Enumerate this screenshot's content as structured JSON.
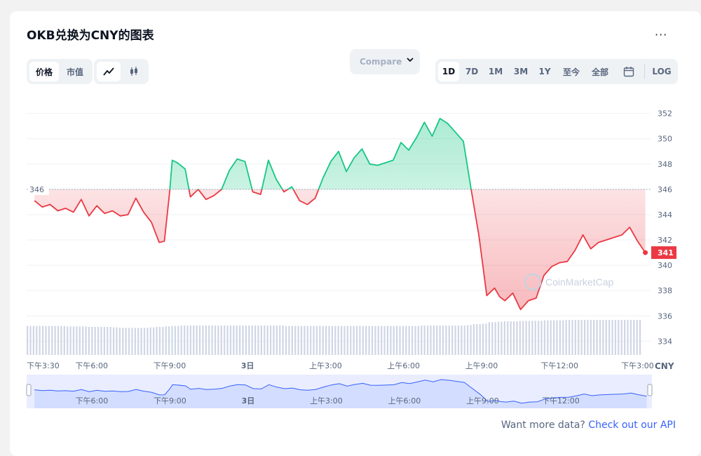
{
  "page": {
    "title": "OKB兑换为CNY的图表",
    "more_label": "···",
    "footer_text": "Want more data?",
    "footer_link": "Check out our API",
    "watermark": "CoinMarketCap"
  },
  "toolbar": {
    "metric_tabs": [
      "价格",
      "市值"
    ],
    "compare_label": "Compare",
    "ranges": [
      "1D",
      "7D",
      "1M",
      "3M",
      "1Y",
      "至今",
      "全部"
    ],
    "log_label": "LOG"
  },
  "chart_data": {
    "type": "line",
    "currency": "CNY",
    "yticks": [
      334,
      336,
      338,
      340,
      342,
      344,
      346,
      348,
      350,
      352
    ],
    "ylim": [
      332.8,
      353.2
    ],
    "reference_value": 346,
    "reference_label": "346",
    "current_value": 341,
    "current_label": "341",
    "xlim": [
      0,
      24
    ],
    "xticks": [
      {
        "t": 0.0,
        "label": "下午3:30"
      },
      {
        "t": 2.5,
        "label": "下午6:00"
      },
      {
        "t": 5.5,
        "label": "下午9:00"
      },
      {
        "t": 8.5,
        "label": "3日"
      },
      {
        "t": 11.5,
        "label": "上午3:00"
      },
      {
        "t": 14.5,
        "label": "上午6:00"
      },
      {
        "t": 17.5,
        "label": "上午9:00"
      },
      {
        "t": 20.5,
        "label": "下午12:00"
      },
      {
        "t": 23.5,
        "label": "下午3:00"
      }
    ],
    "navigator_ticks": [
      {
        "t": 2.5,
        "label": "下午6:00"
      },
      {
        "t": 5.5,
        "label": "下午9:00"
      },
      {
        "t": 8.5,
        "label": "3日"
      },
      {
        "t": 11.5,
        "label": "上午3:00"
      },
      {
        "t": 14.5,
        "label": "上午6:00"
      },
      {
        "t": 17.5,
        "label": "上午9:00"
      },
      {
        "t": 20.5,
        "label": "下午12:00"
      }
    ],
    "series": [
      {
        "x": [
          0.3,
          0.6,
          0.9,
          1.2,
          1.5,
          1.8,
          2.1,
          2.4,
          2.7,
          3.0,
          3.3,
          3.6,
          3.9,
          4.2,
          4.5,
          4.8,
          5.1,
          5.3,
          5.5,
          5.6,
          5.8,
          6.1,
          6.3,
          6.6,
          6.9,
          7.2,
          7.5,
          7.8,
          8.1,
          8.4,
          8.7,
          9.0,
          9.3,
          9.6,
          9.9,
          10.2,
          10.5,
          10.8,
          11.1,
          11.4,
          11.7,
          12.0,
          12.3,
          12.6,
          12.9,
          13.2,
          13.5,
          13.8,
          14.1,
          14.4,
          14.7,
          15.0,
          15.3,
          15.6,
          15.9,
          16.2,
          16.5,
          16.8,
          17.1,
          17.4,
          17.7,
          18.0,
          18.2,
          18.4,
          18.7,
          19.0,
          19.3,
          19.6,
          19.9,
          20.2,
          20.5,
          20.8,
          21.1,
          21.4,
          21.7,
          22.0,
          22.3,
          22.6,
          22.9,
          23.2,
          23.5,
          23.8
        ],
        "y": [
          345.1,
          344.6,
          344.8,
          344.3,
          344.5,
          344.2,
          345.2,
          343.9,
          344.7,
          344.1,
          344.3,
          343.9,
          344.0,
          345.3,
          344.2,
          343.4,
          341.8,
          341.9,
          345.8,
          348.3,
          348.1,
          347.6,
          345.4,
          346.0,
          345.2,
          345.5,
          346.0,
          347.5,
          348.4,
          348.2,
          345.8,
          345.6,
          348.3,
          346.8,
          345.8,
          346.2,
          345.1,
          344.8,
          345.3,
          346.9,
          348.2,
          349.0,
          347.4,
          348.5,
          349.2,
          348.0,
          347.9,
          348.1,
          348.3,
          349.7,
          349.1,
          350.1,
          351.3,
          350.2,
          351.6,
          351.2,
          350.5,
          349.8,
          346.0,
          342.3,
          337.6,
          338.2,
          337.5,
          337.2,
          337.8,
          336.5,
          337.2,
          337.4,
          339.2,
          339.9,
          340.2,
          340.3,
          341.2,
          342.4,
          341.3,
          341.8,
          342.0,
          342.2,
          342.4,
          343.0,
          341.9,
          341.0
        ],
        "volume": [
          0.62,
          0.62,
          0.62,
          0.62,
          0.62,
          0.61,
          0.61,
          0.61,
          0.6,
          0.6,
          0.6,
          0.59,
          0.58,
          0.58,
          0.58,
          0.58,
          0.59,
          0.6,
          0.61,
          0.62,
          0.63,
          0.63,
          0.63,
          0.63,
          0.63,
          0.63,
          0.63,
          0.63,
          0.63,
          0.63,
          0.63,
          0.63,
          0.63,
          0.63,
          0.62,
          0.62,
          0.62,
          0.62,
          0.62,
          0.62,
          0.62,
          0.62,
          0.62,
          0.62,
          0.62,
          0.62,
          0.62,
          0.62,
          0.62,
          0.62,
          0.62,
          0.62,
          0.63,
          0.63,
          0.63,
          0.63,
          0.63,
          0.63,
          0.64,
          0.66,
          0.67,
          0.7,
          0.71,
          0.72,
          0.72,
          0.73,
          0.73,
          0.73,
          0.74,
          0.74,
          0.74,
          0.75,
          0.75,
          0.75,
          0.75,
          0.75,
          0.75,
          0.75,
          0.75,
          0.75,
          0.75,
          0.75
        ]
      }
    ],
    "colors": {
      "up": "#16c784",
      "down": "#ea3943",
      "volume": "#cfd6e4",
      "navigator": "#3861fb"
    }
  }
}
